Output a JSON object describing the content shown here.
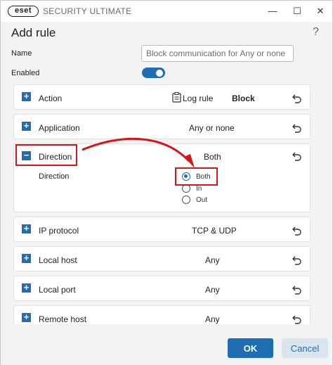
{
  "window": {
    "logo_text": "eset",
    "app_name": "SECURITY ULTIMATE",
    "minimize_glyph": "—",
    "maximize_glyph": "☐",
    "close_glyph": "✕"
  },
  "dialog": {
    "title": "Add rule",
    "help_glyph": "?"
  },
  "fields": {
    "name_label": "Name",
    "name_placeholder": "Block communication for Any or none",
    "enabled_label": "Enabled",
    "enabled_on": true
  },
  "sections": {
    "action": {
      "title": "Action",
      "log_label": "Log rule",
      "value": "Block"
    },
    "application": {
      "title": "Application",
      "value": "Any or none"
    },
    "direction": {
      "title": "Direction",
      "value": "Both",
      "option_label": "Direction",
      "options": [
        "Both",
        "In",
        "Out"
      ],
      "selected": "Both"
    },
    "ip_protocol": {
      "title": "IP protocol",
      "value": "TCP & UDP"
    },
    "local_host": {
      "title": "Local host",
      "value": "Any"
    },
    "local_port": {
      "title": "Local port",
      "value": "Any"
    },
    "remote_host": {
      "title": "Remote host",
      "value": "Any"
    }
  },
  "buttons": {
    "ok": "OK",
    "cancel": "Cancel"
  },
  "colors": {
    "accent": "#1f6db3",
    "annotation": "#d8141b"
  },
  "icons": {
    "expand": "plus-icon",
    "collapse": "minus-icon",
    "reset": "undo-icon",
    "log": "clipboard-icon"
  }
}
